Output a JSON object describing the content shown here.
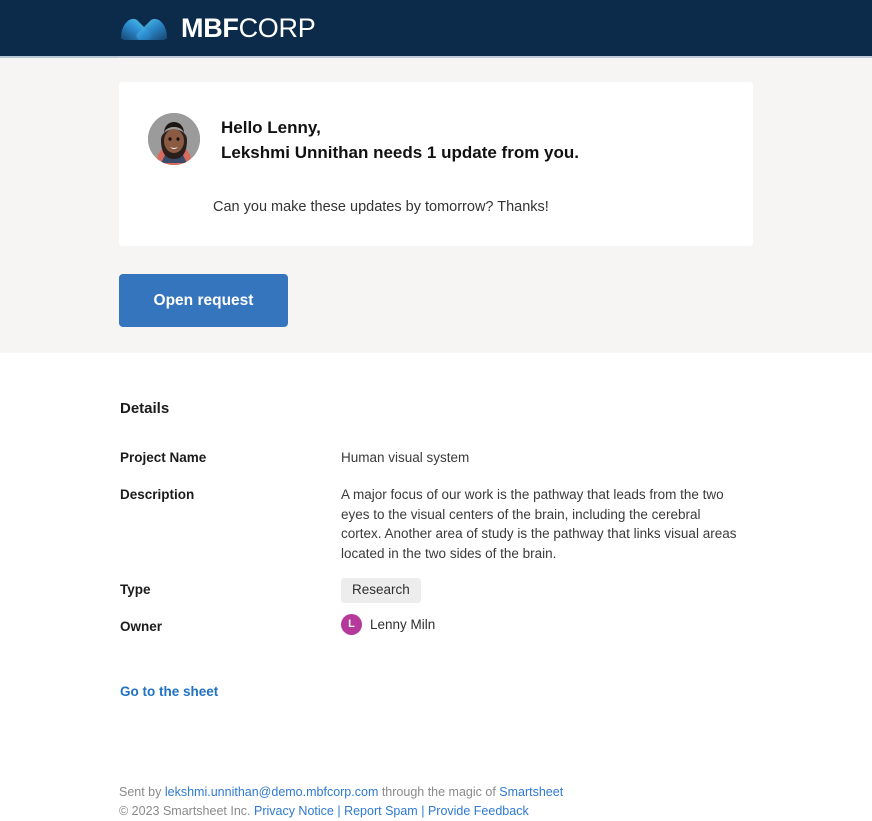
{
  "header": {
    "logo_mark": "mbf-double-chevron-logo",
    "brand_bold": "MBF",
    "brand_light": "CORP"
  },
  "greeting": {
    "avatar_alt": "sender-profile-photo",
    "line1": "Hello Lenny,",
    "line2": "Lekshmi Unnithan needs 1 update from you.",
    "message": "Can you make these updates by tomorrow? Thanks!"
  },
  "cta": {
    "label": "Open request",
    "color": "#3575bd"
  },
  "details": {
    "title": "Details",
    "rows": [
      {
        "label": "Project Name",
        "value": "Human visual system"
      },
      {
        "label": "Description",
        "value": "A major focus of our work is the pathway that leads from the two eyes to the visual centers of the brain, including the cerebral cortex. Another area of study is the pathway that links visual areas located in the two sides of the brain."
      },
      {
        "label": "Type",
        "value": "Research"
      },
      {
        "label": "Owner",
        "value": "Lenny Miln"
      }
    ],
    "owner_initial": "L",
    "owner_avatar_color": "#b5389b",
    "sheet_link": "Go to the sheet"
  },
  "footer": {
    "sent_by_prefix": "Sent by ",
    "sender_email": "lekshmi.unnithan@demo.mbfcorp.com",
    "through_text": " through the magic of ",
    "product": "Smartsheet",
    "copyright": "© 2023 Smartsheet Inc. ",
    "privacy": "Privacy Notice",
    "sep1": " | ",
    "report_spam": "Report Spam",
    "sep2": " | ",
    "feedback": "Provide Feedback"
  }
}
